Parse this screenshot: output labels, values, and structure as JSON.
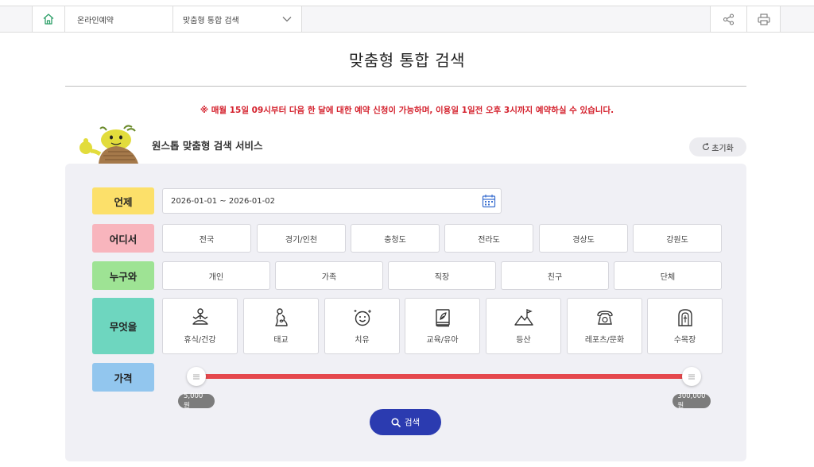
{
  "breadcrumb": {
    "level1": "온라인예약",
    "level2": "맞춤형 통합 검색"
  },
  "page": {
    "title": "맞춤형 통합 검색",
    "notice": "※ 매월 15일 09시부터 다음 한 달에 대한 예약 신청이 가능하며, 이용일 1일전 오후 3시까지 예약하실 수 있습니다."
  },
  "service": {
    "title": "원스톱 맞춤형 검색 서비스",
    "reset_label": "초기화"
  },
  "labels": {
    "when": "언제",
    "where": "어디서",
    "who": "누구와",
    "what": "무엇을",
    "price": "가격"
  },
  "date_range": "2026-01-01 ~ 2026-01-02",
  "regions": [
    "전국",
    "경기/인천",
    "충청도",
    "전라도",
    "경상도",
    "강원도"
  ],
  "companions": [
    "개인",
    "가족",
    "직장",
    "친구",
    "단체"
  ],
  "themes": [
    {
      "label": "휴식/건강",
      "icon": "meditation-icon"
    },
    {
      "label": "태교",
      "icon": "pregnancy-icon"
    },
    {
      "label": "치유",
      "icon": "smile-icon"
    },
    {
      "label": "교육/유아",
      "icon": "book-icon"
    },
    {
      "label": "등산",
      "icon": "mountain-icon"
    },
    {
      "label": "레포츠/문화",
      "icon": "telephone-icon"
    },
    {
      "label": "수목장",
      "icon": "memorial-icon"
    }
  ],
  "price": {
    "min_label": "5,000원",
    "max_label": "300,000원"
  },
  "search_label": "검색",
  "colors": {
    "when": "#fce06a",
    "where": "#f8b5bd",
    "who": "#9ee394",
    "what": "#6ed6bf",
    "price": "#92c6ee",
    "notice": "#d4202c",
    "slider": "#e5484d",
    "search_button": "#2b3bb0"
  }
}
